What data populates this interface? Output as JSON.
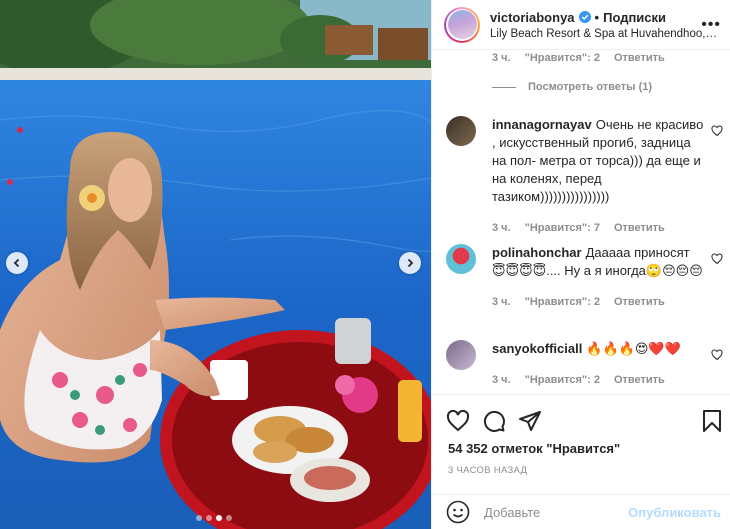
{
  "post": {
    "carousel_dots": 4,
    "active_dot": 3
  },
  "header": {
    "username": "victoriabonya",
    "separator": "•",
    "follow_label": "Подписки",
    "location": "Lily Beach Resort & Spa at Huvahendhoo, ...",
    "more_label": "•••"
  },
  "comments": {
    "top_meta": {
      "time": "3 ч.",
      "likes": "\"Нравится\": 2",
      "reply": "Ответить"
    },
    "show_replies": "Посмотреть ответы (1)",
    "items": [
      {
        "user": "innanagornayav",
        "text": "Очень не красиво , искусственный прогиб, задница на пол- метра от торса))) да еще и на коленях, перед тазиком))))))))))))))))",
        "time": "3 ч.",
        "likes": "\"Нравится\": 7",
        "reply": "Ответить"
      },
      {
        "user": "polinahonchar",
        "text": "Дааааа приносят 😇😇😇😇.... Ну а я иногда🙄😔😔😔",
        "time": "3 ч.",
        "likes": "\"Нравится\": 2",
        "reply": "Ответить"
      },
      {
        "user": "sanyokofficiall",
        "text": "🔥🔥🔥😍❤️❤️",
        "time": "3 ч.",
        "likes": "\"Нравится\": 2",
        "reply": "Ответить"
      }
    ]
  },
  "footer": {
    "likes_count": "54 352 отметок \"Нравится\"",
    "time_ago": "3 ЧАСОВ НАЗАД",
    "add_comment_placeholder": "Добавьте",
    "publish_label": "Опубликовать"
  },
  "colors": {
    "accent": "#0095f6",
    "publish_disabled": "#b3dbff",
    "muted": "#8e8e8e",
    "text": "#262626"
  }
}
